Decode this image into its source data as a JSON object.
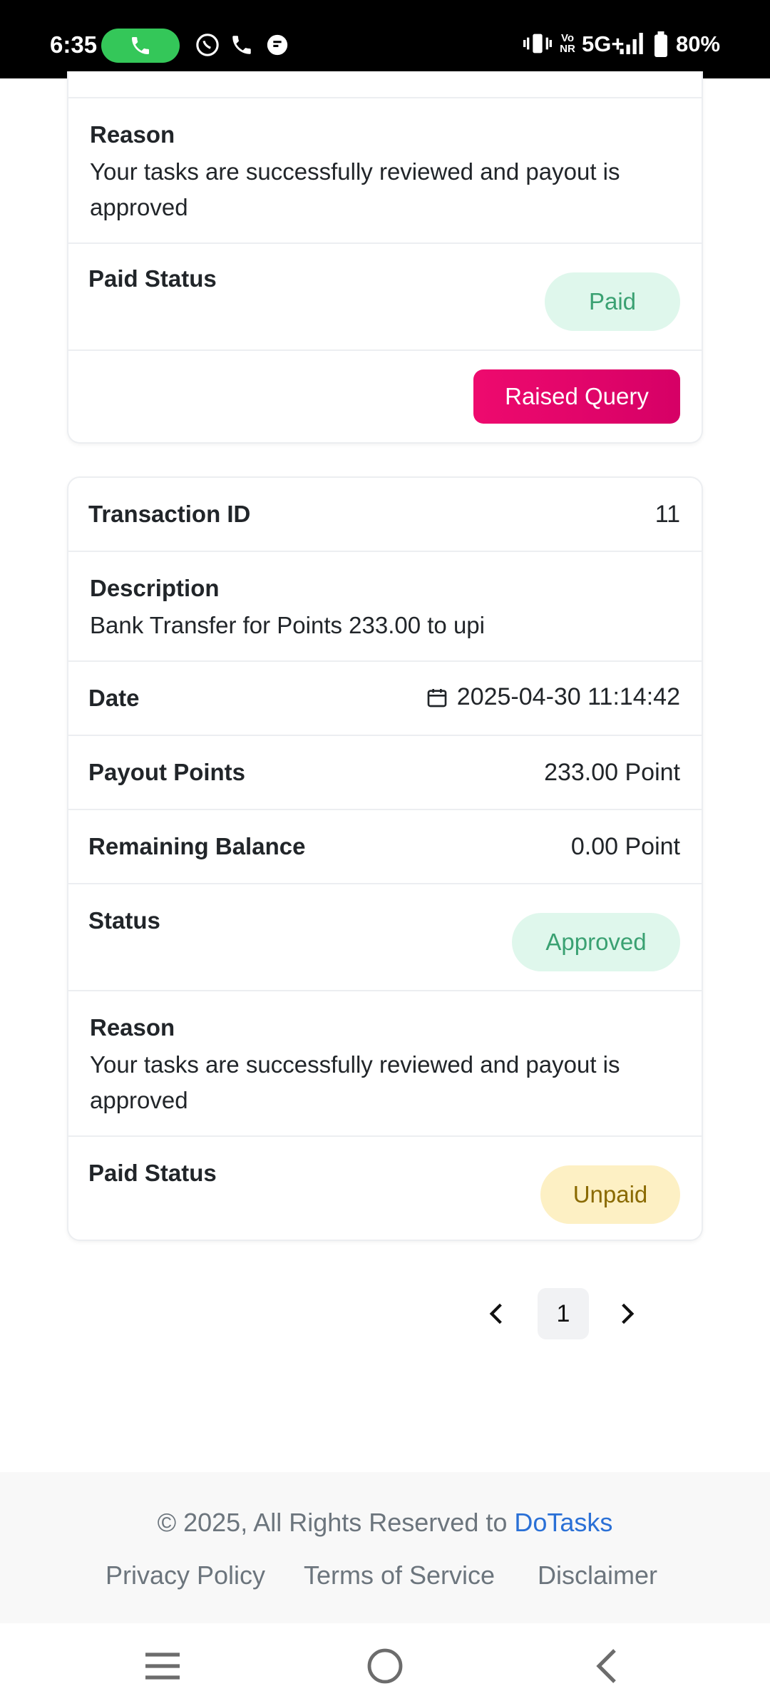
{
  "status_bar": {
    "time": "6:35",
    "network": "5G+",
    "battery": "80%",
    "volte": "Vo NR",
    "icons": [
      "call-icon",
      "whatsapp-icon",
      "phone-icon",
      "chat-icon",
      "vibrate-icon",
      "signal-icon",
      "battery-icon"
    ]
  },
  "card1": {
    "reason_label": "Reason",
    "reason_text": "Your tasks are successfully reviewed and payout is approved",
    "paid_status_label": "Paid Status",
    "paid_status": "Paid",
    "query_button": "Raised Query"
  },
  "card2": {
    "transaction_id_label": "Transaction ID",
    "transaction_id": "11",
    "description_label": "Description",
    "description": "Bank Transfer for Points 233.00 to upi",
    "date_label": "Date",
    "date": "2025-04-30 11:14:42",
    "payout_label": "Payout Points",
    "payout": "233.00 Point",
    "balance_label": "Remaining Balance",
    "balance": "0.00 Point",
    "status_label": "Status",
    "status": "Approved",
    "reason_label": "Reason",
    "reason_text": "Your tasks are successfully reviewed and payout is approved",
    "paid_status_label": "Paid Status",
    "paid_status": "Unpaid"
  },
  "pagination": {
    "current": "1"
  },
  "footer": {
    "copyright": "© 2025, All Rights Reserved to",
    "brand": "DoTasks",
    "links": [
      "Privacy Policy",
      "Terms of Service",
      "Disclaimer"
    ]
  },
  "colors": {
    "accent_pink": "#e6086c",
    "paid_green": "#3aa172",
    "unpaid_yellow": "#8a6a00",
    "link_blue": "#2a70d6"
  }
}
